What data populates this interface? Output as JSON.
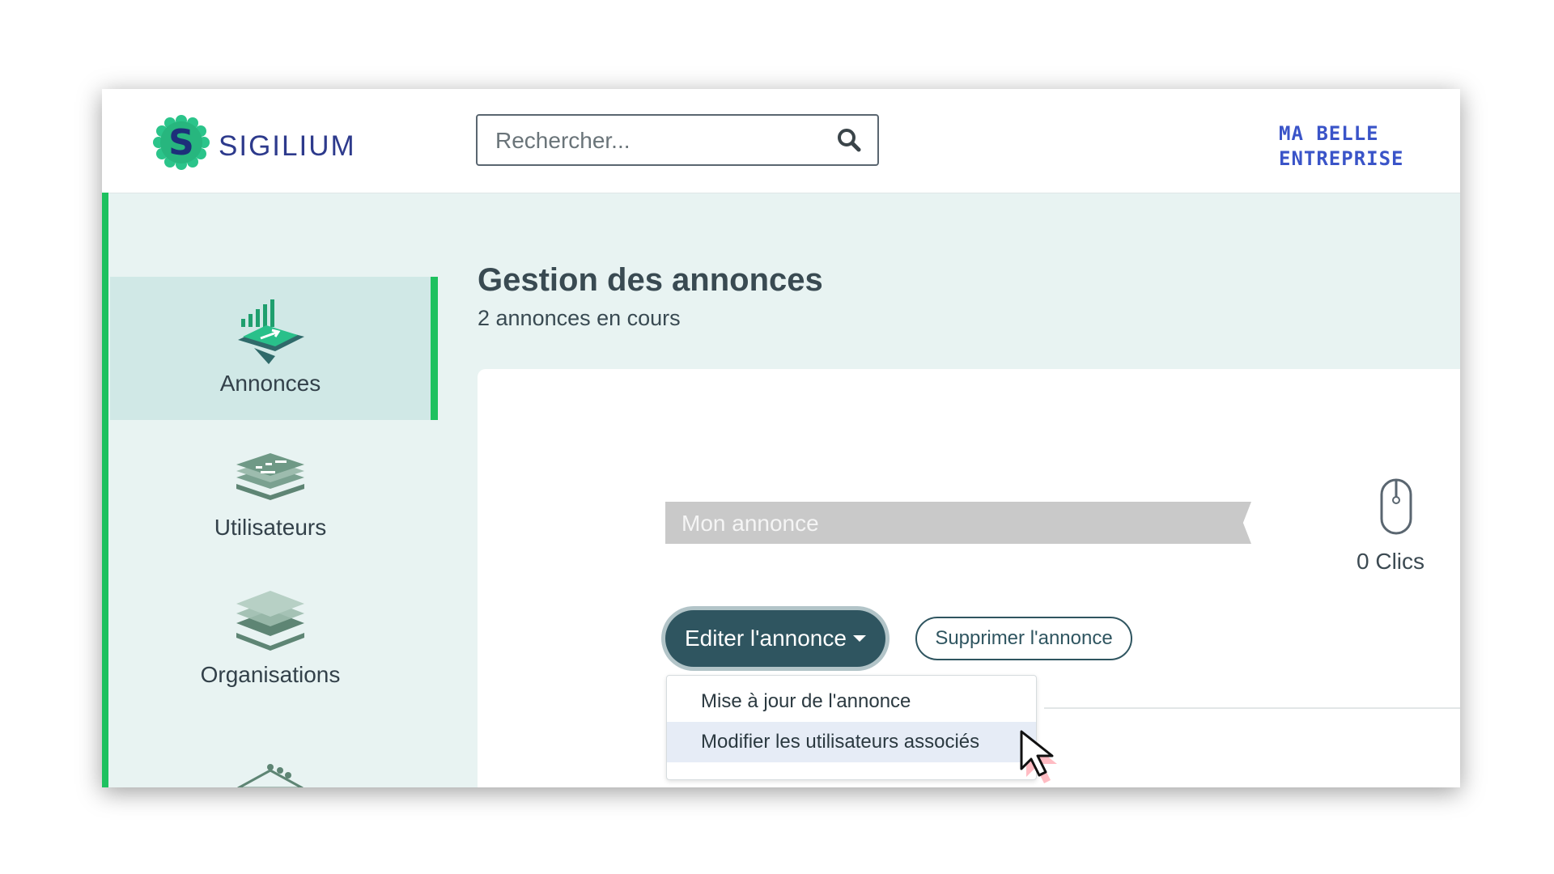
{
  "header": {
    "brand": "SIGILIUM",
    "search_placeholder": "Rechercher...",
    "company_line1": "MA BELLE",
    "company_line2": "ENTREPRISE"
  },
  "sidebar": {
    "items": [
      {
        "label": "Annonces",
        "icon": "chart-announcement-icon",
        "active": true
      },
      {
        "label": "Utilisateurs",
        "icon": "users-stack-icon",
        "active": false
      },
      {
        "label": "Organisations",
        "icon": "layers-icon",
        "active": false
      }
    ]
  },
  "page": {
    "title": "Gestion des annonces",
    "subtitle": "2 annonces en cours"
  },
  "ad": {
    "name": "Mon annonce",
    "clicks": "0 Clics",
    "edit_label": "Editer l'annonce",
    "delete_label": "Supprimer l'annonce",
    "menu": [
      {
        "label": "Mise à jour de l'annonce"
      },
      {
        "label": "Modifier les utilisateurs associés"
      }
    ]
  },
  "colors": {
    "accent_green": "#1ec15f",
    "teal_dark": "#2f5560",
    "background": "#e8f3f2",
    "brand_blue": "#2d3a8c"
  }
}
